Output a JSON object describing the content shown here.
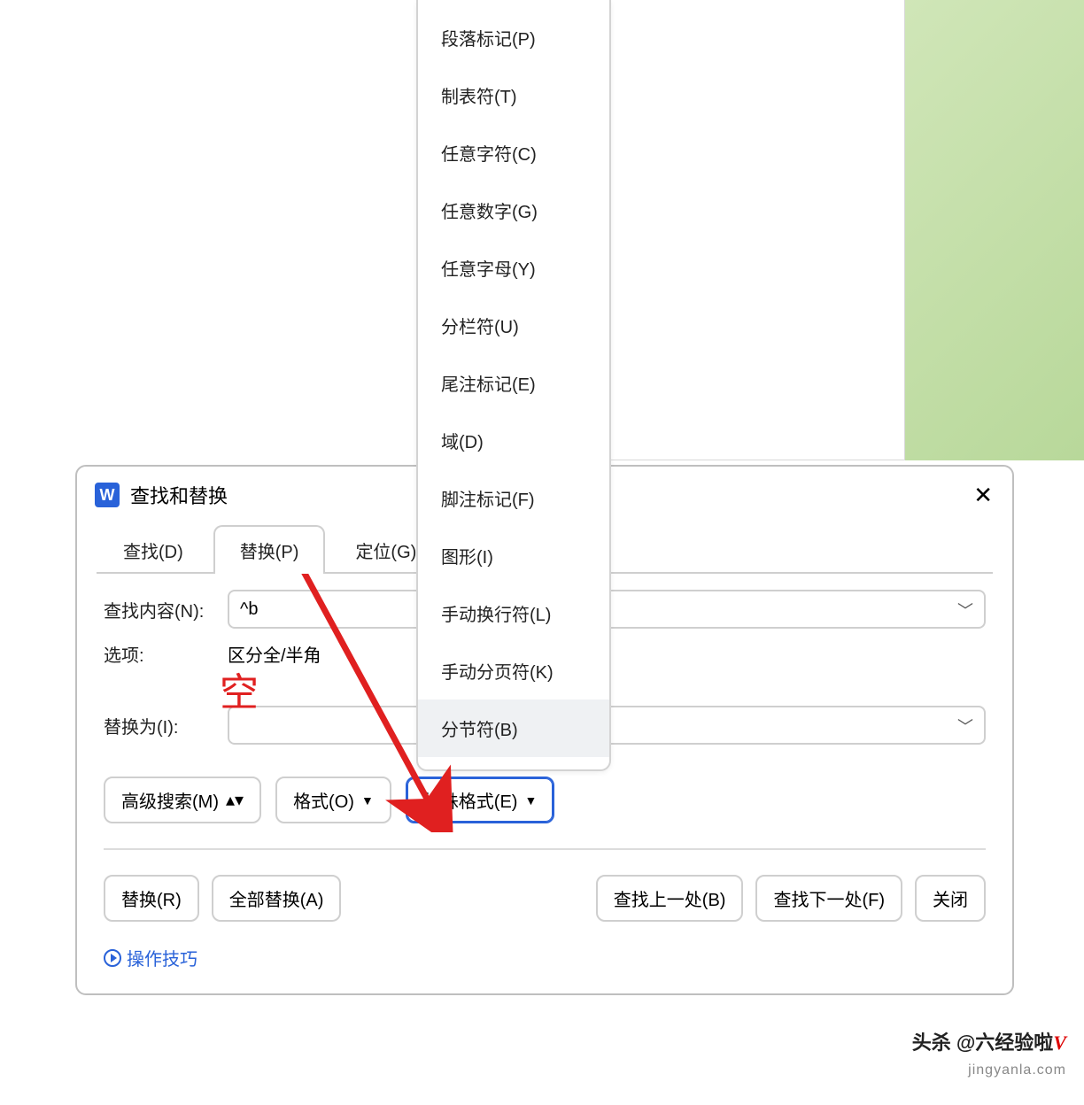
{
  "dialog": {
    "title": "查找和替换",
    "app_letter": "W",
    "tabs": {
      "find": "查找(D)",
      "replace": "替换(P)",
      "goto": "定位(G)"
    },
    "find_label": "查找内容(N):",
    "find_value": "^b",
    "options_label": "选项:",
    "options_value": "区分全/半角",
    "replace_label": "替换为(I):",
    "replace_value": "",
    "buttons": {
      "advanced": "高级搜索(M)",
      "format": "格式(O)",
      "special": "特殊格式(E)",
      "replace": "替换(R)",
      "replace_all": "全部替换(A)",
      "find_prev": "查找上一处(B)",
      "find_next": "查找下一处(F)",
      "close": "关闭"
    },
    "tips_link": "操作技巧"
  },
  "menu": {
    "items": [
      "段落标记(P)",
      "制表符(T)",
      "任意字符(C)",
      "任意数字(G)",
      "任意字母(Y)",
      "分栏符(U)",
      "尾注标记(E)",
      "域(D)",
      "脚注标记(F)",
      "图形(I)",
      "手动换行符(L)",
      "手动分页符(K)",
      "分节符(B)"
    ],
    "highlight_index": 12
  },
  "annotation": {
    "empty_label": "空"
  },
  "watermark": {
    "line1_prefix": "头杀 @六经验啦",
    "v": "V",
    "line2": "jingyanla.com"
  }
}
